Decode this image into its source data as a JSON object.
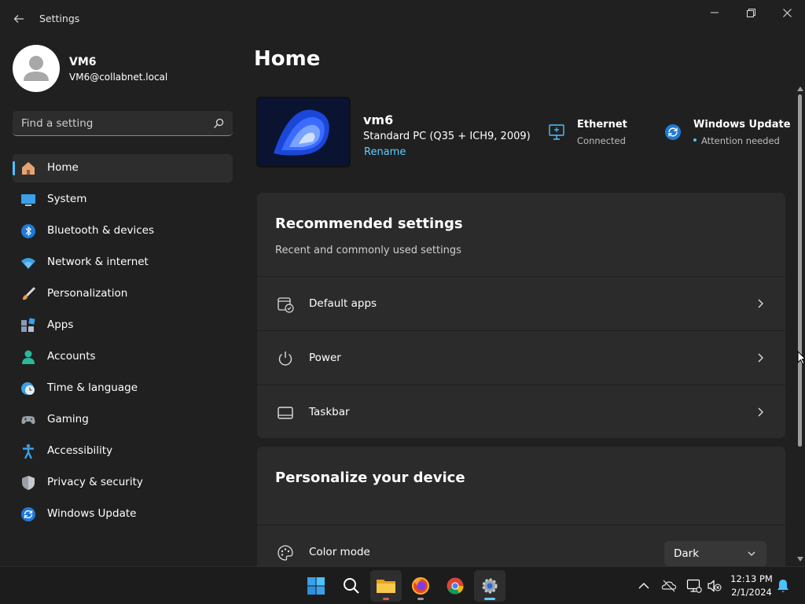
{
  "app": {
    "title": "Settings"
  },
  "profile": {
    "name": "VM6",
    "email": "VM6@collabnet.local"
  },
  "search": {
    "placeholder": "Find a setting"
  },
  "sidebar": {
    "items": [
      {
        "label": "Home",
        "icon": "home-icon",
        "active": true
      },
      {
        "label": "System",
        "icon": "system-icon"
      },
      {
        "label": "Bluetooth & devices",
        "icon": "bluetooth-icon"
      },
      {
        "label": "Network & internet",
        "icon": "wifi-icon"
      },
      {
        "label": "Personalization",
        "icon": "brush-icon"
      },
      {
        "label": "Apps",
        "icon": "apps-icon"
      },
      {
        "label": "Accounts",
        "icon": "accounts-icon"
      },
      {
        "label": "Time & language",
        "icon": "clock-globe-icon"
      },
      {
        "label": "Gaming",
        "icon": "gamepad-icon"
      },
      {
        "label": "Accessibility",
        "icon": "accessibility-icon"
      },
      {
        "label": "Privacy & security",
        "icon": "shield-icon"
      },
      {
        "label": "Windows Update",
        "icon": "update-icon"
      }
    ]
  },
  "main": {
    "title": "Home",
    "device": {
      "name": "vm6",
      "model": "Standard PC (Q35 + ICH9, 2009)",
      "rename_label": "Rename"
    },
    "status": {
      "ethernet": {
        "title": "Ethernet",
        "subtitle": "Connected"
      },
      "update": {
        "title": "Windows Update",
        "subtitle": "Attention needed"
      }
    },
    "recommended": {
      "title": "Recommended settings",
      "subtitle": "Recent and commonly used settings",
      "rows": [
        {
          "label": "Default apps",
          "icon": "default-apps-icon"
        },
        {
          "label": "Power",
          "icon": "power-icon"
        },
        {
          "label": "Taskbar",
          "icon": "taskbar-icon"
        }
      ]
    },
    "personalize": {
      "title": "Personalize your device",
      "color_mode": {
        "label": "Color mode",
        "value": "Dark"
      }
    }
  },
  "taskbar": {
    "apps": [
      "start-icon",
      "search-icon",
      "file-explorer-icon",
      "firefox-icon",
      "chrome-icon",
      "settings-icon"
    ],
    "clock": {
      "time": "12:13 PM",
      "date": "2/1/2024"
    }
  },
  "colors": {
    "accent": "#4cc2ff",
    "link": "#60cdff",
    "background": "#202020",
    "card": "#2b2b2b"
  }
}
